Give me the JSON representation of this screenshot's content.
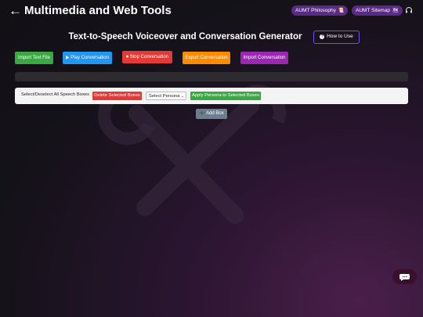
{
  "header": {
    "back_arrow": "←",
    "site_title": "Multimedia and Web Tools",
    "pills": [
      {
        "label": "AUMT Philosophy",
        "icon": "scroll-icon"
      },
      {
        "label": "AUMT Sitemap",
        "icon": "sitemap-icon"
      }
    ],
    "headset_icon": "headphones-icon"
  },
  "main": {
    "title": "Text-to-Speech Voiceover and Conversation Generator",
    "how_to_use": "How to Use",
    "actions": {
      "import_text": "Import Text File",
      "play": "Play Conversation",
      "stop": "Stop Conversation",
      "export": "Export Conversation",
      "import_conv": "Import Conversation"
    },
    "toolbar": {
      "select_all": "Select/Deselect All Speech Boxes",
      "delete": "Delete Selected Boxes",
      "persona_select": "Select Persona",
      "apply": "Apply Persona to Selected Boxes"
    },
    "add_box": "Add Box"
  },
  "colors": {
    "green": "#3aa944",
    "blue": "#2196f3",
    "red": "#e53935",
    "orange": "#fb8c00",
    "purple": "#9c27b0",
    "pill": "#5b2a86",
    "accent_border": "#6a55e8"
  }
}
